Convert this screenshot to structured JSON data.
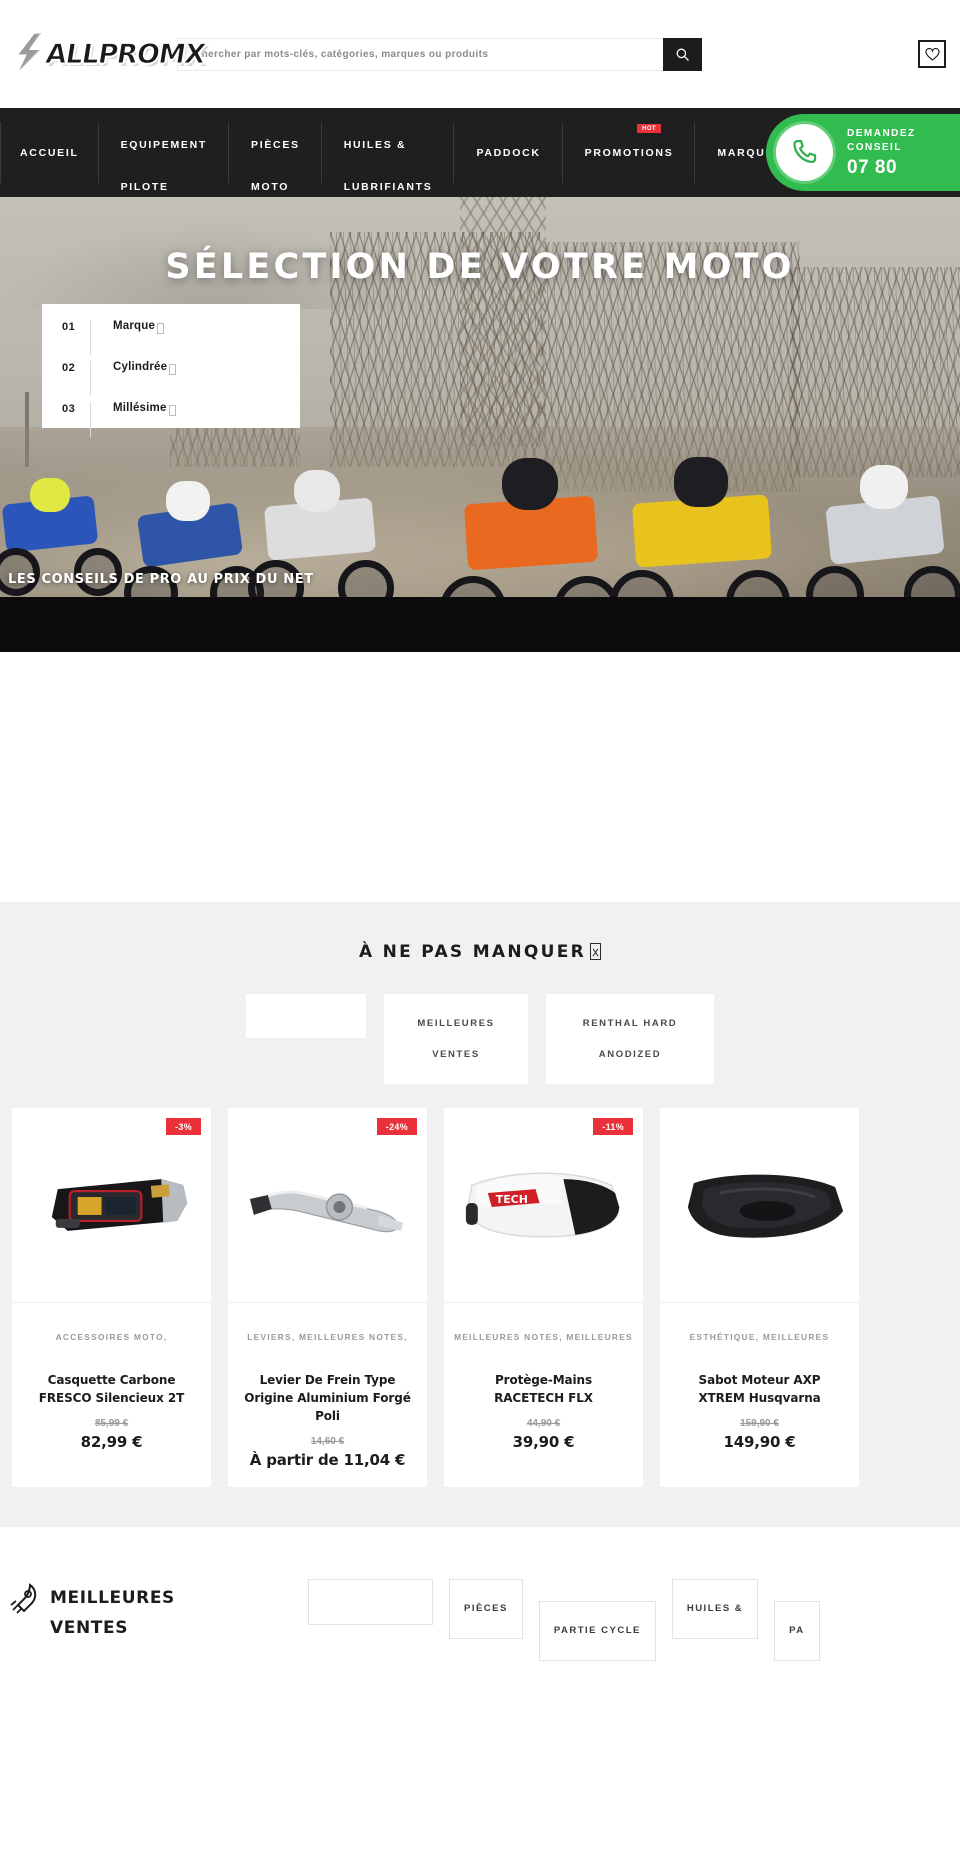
{
  "header": {
    "logo_text": "ALLPROMX",
    "search": {
      "placeholder": "Chercher par mots-clés, catégories, marques ou produits",
      "value": "",
      "button_icon": "search-icon"
    },
    "wishlist_icon": "heart-icon"
  },
  "nav": {
    "items": [
      {
        "label": "ACCUEIL"
      },
      {
        "label": "EQUIPEMENT\nPILOTE"
      },
      {
        "label": "PIÈCES\nMOTO"
      },
      {
        "label": "HUILES &\nLUBRIFIANTS"
      },
      {
        "label": "PADDOCK"
      },
      {
        "label": "PROMOTIONS",
        "badge": "HOT"
      },
      {
        "label": "MARQUES"
      }
    ],
    "phone_widget": {
      "icon": "phone-icon",
      "line1": "DEMANDEZ",
      "line2": "CONSEIL",
      "number": "07 80"
    }
  },
  "hero": {
    "title": "SÉLECTION DE VOTRE MOTO",
    "tagline": "LES CONSEILS DE PRO AU PRIX DU NET",
    "selector": [
      {
        "num": "01",
        "label": "Marque"
      },
      {
        "num": "02",
        "label": "Cylindrée"
      },
      {
        "num": "03",
        "label": "Millésime"
      }
    ]
  },
  "promo": {
    "title": "À NE PAS MANQUER",
    "title_glyph": "missing-glyph",
    "tabs": [
      {
        "label": ""
      },
      {
        "label": "MEILLEURES\nVENTES"
      },
      {
        "label": "RENTHAL HARD\nANODIZED"
      }
    ],
    "products": [
      {
        "badge": "-3%",
        "categories": "ACCESSOIRES MOTO,",
        "name": "Casquette Carbone FRESCO\nSilencieux 2T",
        "old_price": "85,99 €",
        "price": "82,99 €",
        "image": "exhaust-silencer"
      },
      {
        "badge": "-24%",
        "categories": "LEVIERS, MEILLEURES NOTES,",
        "name": "Levier De Frein Type Origine\nAluminium Forgé Poli",
        "old_price": "14,60 €",
        "price": "À partir de 11,04 €",
        "image": "brake-lever"
      },
      {
        "badge": "-11%",
        "categories": "MEILLEURES NOTES, MEILLEURES",
        "name": "Protège-Mains RACETECH FLX",
        "old_price": "44,90 €",
        "price": "39,90 €",
        "image": "handguard"
      },
      {
        "badge": "",
        "categories": "ESTHÉTIQUE, MEILLEURES",
        "name": "Sabot Moteur AXP XTREM\nHusqvarna",
        "old_price": "159,90 €",
        "price": "149,90 €",
        "image": "skid-plate"
      }
    ]
  },
  "bottom": {
    "icon": "rocket-icon",
    "title": "MEILLEURES\nVENTES",
    "tabs": [
      {
        "label": ""
      },
      {
        "label": "PIÈCES"
      },
      {
        "label": "PARTIE CYCLE"
      },
      {
        "label": "HUILES &"
      },
      {
        "label": "PA"
      }
    ]
  },
  "colors": {
    "accent_red": "#e8313a",
    "dark": "#1f1f1f",
    "green": "#32bb4e",
    "panel_bg": "#f1f1f1"
  }
}
